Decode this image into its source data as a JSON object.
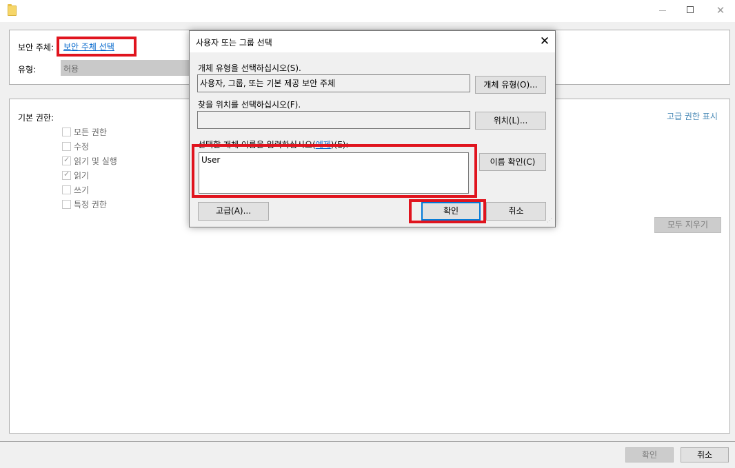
{
  "window": {
    "subject_label": "보안 주체:",
    "subject_link": "보안 주체 선택",
    "type_label": "유형:",
    "type_value": "허용",
    "basic_perm_label": "기본 권한:",
    "permissions": [
      {
        "label": "모든 권한",
        "checked": false
      },
      {
        "label": "수정",
        "checked": false
      },
      {
        "label": "읽기 및 실행",
        "checked": true
      },
      {
        "label": "읽기",
        "checked": true
      },
      {
        "label": "쓰기",
        "checked": false
      },
      {
        "label": "특정 권한",
        "checked": false
      }
    ],
    "advanced_link": "고급 권한 표시",
    "clear_all": "모두 지우기",
    "ok": "확인",
    "cancel": "취소"
  },
  "dialog": {
    "title": "사용자 또는 그룹 선택",
    "object_type_label": "개체 유형을 선택하십시오(S).",
    "object_type_value": "사용자, 그룹, 또는 기본 제공 보안 주체",
    "object_type_btn": "개체 유형(O)...",
    "location_label": "찾을 위치를 선택하십시오(F).",
    "location_value": "",
    "location_btn": "위치(L)...",
    "names_label_pre": "선택할 개체 이름을 입력하십시오(",
    "names_label_link": "예제",
    "names_label_post": ")(E):",
    "names_value": "User",
    "check_names_btn": "이름 확인(C)",
    "advanced_btn": "고급(A)...",
    "ok": "확인",
    "cancel": "취소"
  },
  "colors": {
    "highlight": "#e0141e",
    "link": "#0066cc",
    "primary_border": "#0078d7"
  }
}
